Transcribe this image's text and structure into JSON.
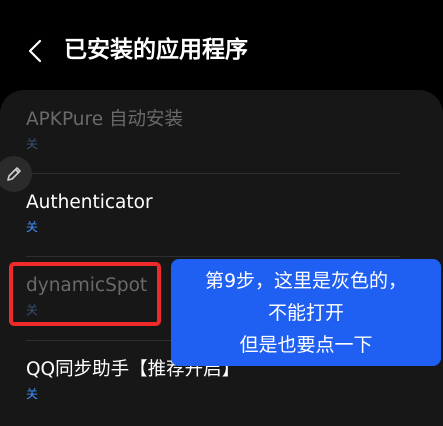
{
  "header": {
    "title": "已安装的应用程序"
  },
  "apps": [
    {
      "name": "APKPure 自动安装",
      "status": "关",
      "enabled": false
    },
    {
      "name": "Authenticator",
      "status": "关",
      "enabled": true
    },
    {
      "name": "dynamicSpot",
      "status": "关",
      "enabled": false
    },
    {
      "name": "QQ同步助手【推荐开启】",
      "status": "关",
      "enabled": true
    }
  ],
  "annotation": {
    "lines": [
      "第9步，这里是灰色的，",
      "不能打开",
      "但是也要点一下"
    ],
    "callout_color": "#1f5ff2",
    "highlight_color": "#ee2a2a"
  },
  "colors": {
    "background": "#000000",
    "card": "#171717",
    "accent": "#3e91ff"
  }
}
